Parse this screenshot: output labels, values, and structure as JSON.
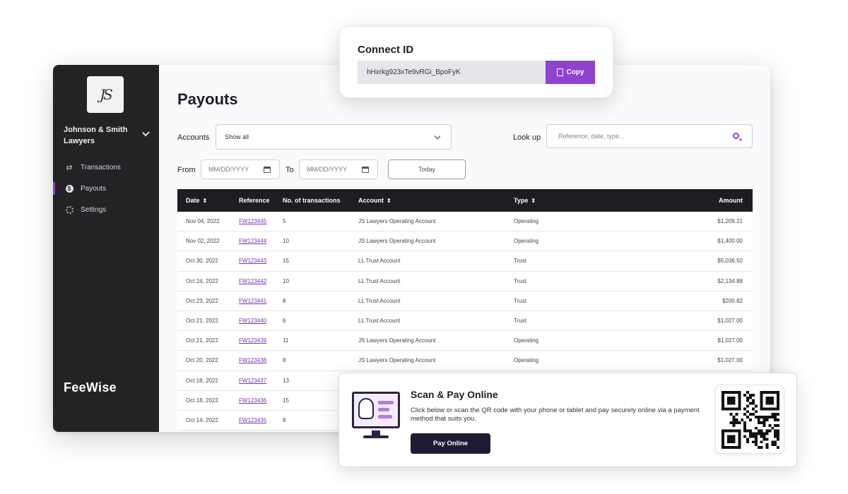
{
  "sidebar": {
    "logo_text": "JS",
    "firm_name": "Johnson & Smith Lawyers",
    "items": [
      {
        "label": "Transactions",
        "icon": "transfer-arrows-icon",
        "active": false
      },
      {
        "label": "Payouts",
        "icon": "dollar-coin-icon",
        "active": true
      },
      {
        "label": "Settings",
        "icon": "gear-icon",
        "active": false
      }
    ],
    "brand": "FeeWise"
  },
  "main": {
    "title": "Payouts",
    "accounts_label": "Accounts",
    "accounts_value": "Show all",
    "lookup_label": "Look up",
    "lookup_placeholder": "Reference, date, type...",
    "from_label": "From",
    "to_label": "To",
    "date_placeholder": "MM/DD/YYYY",
    "today_label": "Today"
  },
  "table": {
    "headers": {
      "date": "Date",
      "reference": "Reference",
      "num_transactions": "No. of transactions",
      "account": "Account",
      "type": "Type",
      "amount": "Amount"
    },
    "rows": [
      {
        "date": "Nov 04, 2022",
        "reference": "FW123445",
        "num": "5",
        "account": "JS Lawyers Operating Account",
        "type": "Operating",
        "amount": "$1,209.21"
      },
      {
        "date": "Nov 02, 2022",
        "reference": "FW123444",
        "num": "10",
        "account": "JS Lawyers Operating Account",
        "type": "Operating",
        "amount": "$1,400.00"
      },
      {
        "date": "Oct 30, 2022",
        "reference": "FW123443",
        "num": "15",
        "account": "LL Trust Account",
        "type": "Trust",
        "amount": "$5,036.50"
      },
      {
        "date": "Oct 24, 2022",
        "reference": "FW123442",
        "num": "10",
        "account": "LL Trust Account",
        "type": "Trust",
        "amount": "$2,134.88"
      },
      {
        "date": "Oct 23, 2022",
        "reference": "FW123441",
        "num": "8",
        "account": "LL Trust Account",
        "type": "Trust",
        "amount": "$200.82"
      },
      {
        "date": "Oct 21, 2022",
        "reference": "FW123440",
        "num": "6",
        "account": "LL Trust Account",
        "type": "Trust",
        "amount": "$1,027.00"
      },
      {
        "date": "Oct 21, 2022",
        "reference": "FW123439",
        "num": "11",
        "account": "JS Lawyers Operating Account",
        "type": "Operating",
        "amount": "$1,027.00"
      },
      {
        "date": "Oct 20, 2022",
        "reference": "FW123438",
        "num": "8",
        "account": "JS Lawyers Operating Account",
        "type": "Operating",
        "amount": "$1,027.00"
      },
      {
        "date": "Oct 18, 2022",
        "reference": "FW123437",
        "num": "13",
        "account": "",
        "type": "",
        "amount": ""
      },
      {
        "date": "Oct 18, 2022",
        "reference": "FW123436",
        "num": "15",
        "account": "",
        "type": "",
        "amount": ""
      },
      {
        "date": "Oct 14, 2022",
        "reference": "FW123435",
        "num": "8",
        "account": "",
        "type": "",
        "amount": ""
      }
    ]
  },
  "connect": {
    "title": "Connect ID",
    "value": "hHxrkg923xTe9vRGi_BpoFyK",
    "copy_label": "Copy"
  },
  "pay": {
    "title": "Scan & Pay Online",
    "description": "Click below or scan the QR code with your phone or tablet and pay securely online via a payment method that suits you.",
    "button_label": "Pay Online"
  },
  "colors": {
    "accent": "#8f42cf",
    "sidebar_bg": "#232326",
    "table_header_bg": "#1e1e22",
    "pay_button_bg": "#1e1b33"
  }
}
